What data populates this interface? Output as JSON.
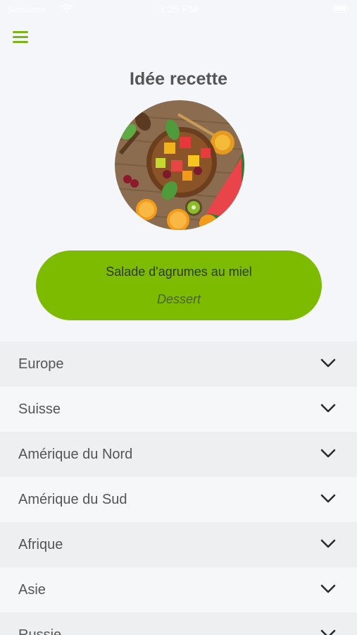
{
  "status_bar": {
    "carrier": "Simulator",
    "time": "3:35 PM"
  },
  "header": {
    "menu_icon": "hamburger-menu-icon",
    "title": "Idée recette"
  },
  "recipe": {
    "image": "fruit-salad-photo",
    "name": "Salade d'agrumes au miel",
    "category": "Dessert"
  },
  "regions": [
    {
      "label": "Europe"
    },
    {
      "label": "Suisse"
    },
    {
      "label": "Amérique du Nord"
    },
    {
      "label": "Amérique du Sud"
    },
    {
      "label": "Afrique"
    },
    {
      "label": "Asie"
    },
    {
      "label": "Russie"
    }
  ],
  "colors": {
    "accent": "#7cb518",
    "card": "#7dbb00",
    "background": "#f4f6f9"
  }
}
